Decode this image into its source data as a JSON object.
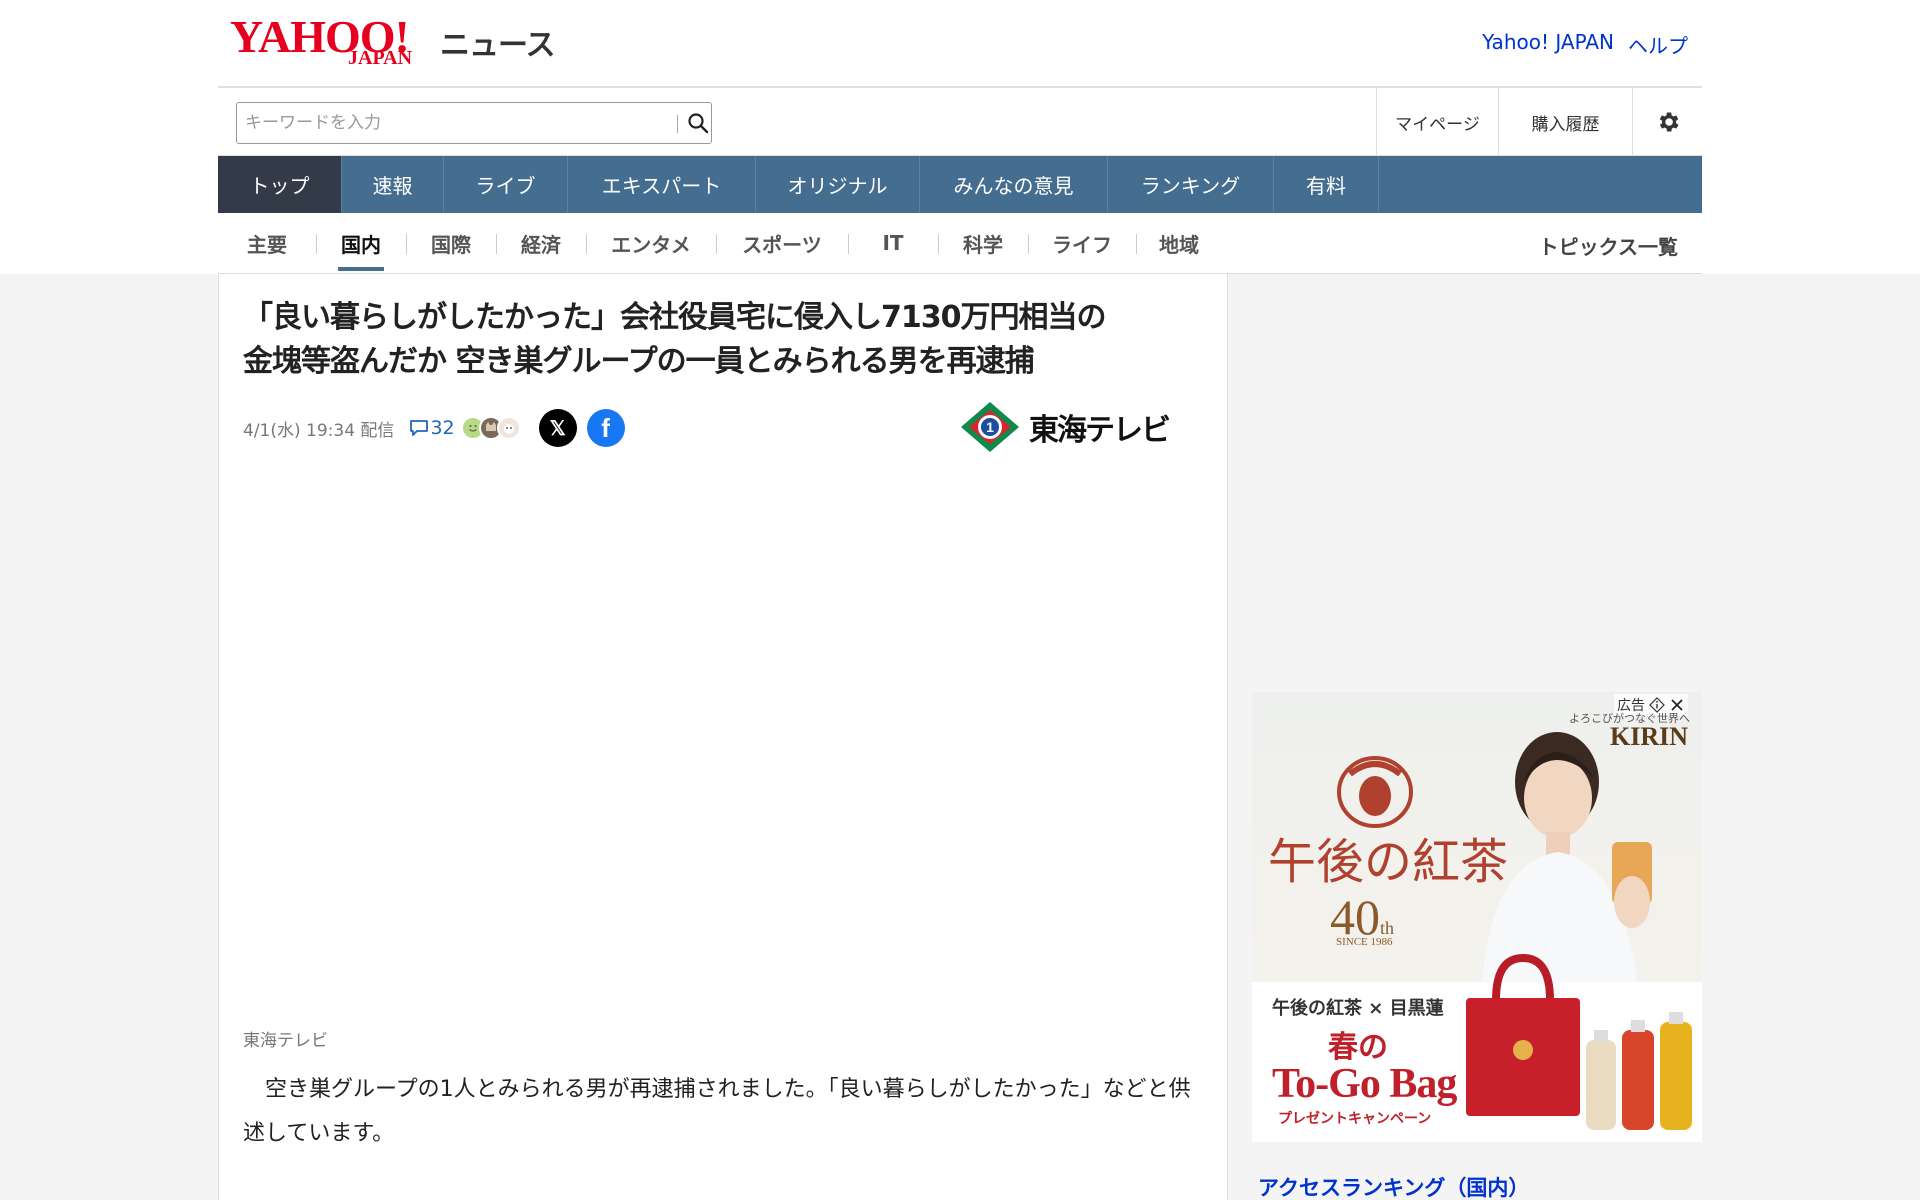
{
  "header": {
    "logo_yahoo": "YAHOO!",
    "logo_japan": "JAPAN",
    "logo_service": "ニュース",
    "links": [
      "Yahoo! JAPAN",
      "ヘルプ"
    ]
  },
  "search": {
    "placeholder": "キーワードを入力",
    "value": ""
  },
  "util_nav": {
    "mypage": "マイページ",
    "history": "購入履歴",
    "settings_icon": "gear-icon"
  },
  "main_nav": [
    {
      "label": "トップ",
      "active": true
    },
    {
      "label": "速報",
      "active": false
    },
    {
      "label": "ライブ",
      "active": false
    },
    {
      "label": "エキスパート",
      "active": false
    },
    {
      "label": "オリジナル",
      "active": false
    },
    {
      "label": "みんなの意見",
      "active": false
    },
    {
      "label": "ランキング",
      "active": false
    },
    {
      "label": "有料",
      "active": false
    }
  ],
  "category_nav": {
    "items": [
      {
        "label": "主要",
        "active": false
      },
      {
        "label": "国内",
        "active": true
      },
      {
        "label": "国際",
        "active": false
      },
      {
        "label": "経済",
        "active": false
      },
      {
        "label": "エンタメ",
        "active": false
      },
      {
        "label": "スポーツ",
        "active": false
      },
      {
        "label": "IT",
        "active": false
      },
      {
        "label": "科学",
        "active": false
      },
      {
        "label": "ライフ",
        "active": false
      },
      {
        "label": "地域",
        "active": false
      }
    ],
    "topics_link": "トピックス一覧"
  },
  "article": {
    "headline_line1": "「良い暮らしがしたかった」会社役員宅に侵入し7130万円相当の",
    "headline_line2": "金塊等盗んだか 空き巣グループの一員とみられる男を再逮捕",
    "date": "4/1(水) 19:34 配信",
    "comment_count": "32",
    "source_logo": "東海テレビ",
    "source_name": "東海テレビ",
    "body": "空き巣グループの1人とみられる男が再逮捕されました。「良い暮らしがしたかった」などと供述しています。"
  },
  "ad": {
    "label": "広告",
    "tagline": "よろこびがつなぐ世界へ",
    "brand": "KIRIN",
    "product": "午後の紅茶",
    "anniversary": "40",
    "anniversary_suffix": "th",
    "since": "SINCE 1986",
    "collab": "午後の紅茶 × 目黒蓮",
    "headline1": "春の",
    "headline2": "To-Go Bag",
    "campaign": "プレゼントキャンペーン",
    "colors": {
      "brand_red": "#c0202a",
      "title_red": "#b1412f"
    }
  },
  "sidebar": {
    "ranking_title": "アクセスランキング（国内）"
  },
  "colors": {
    "nav_bg": "#446d8f",
    "nav_active": "#333b48",
    "link_blue": "#0033cc",
    "logo_red": "#e7001e"
  }
}
